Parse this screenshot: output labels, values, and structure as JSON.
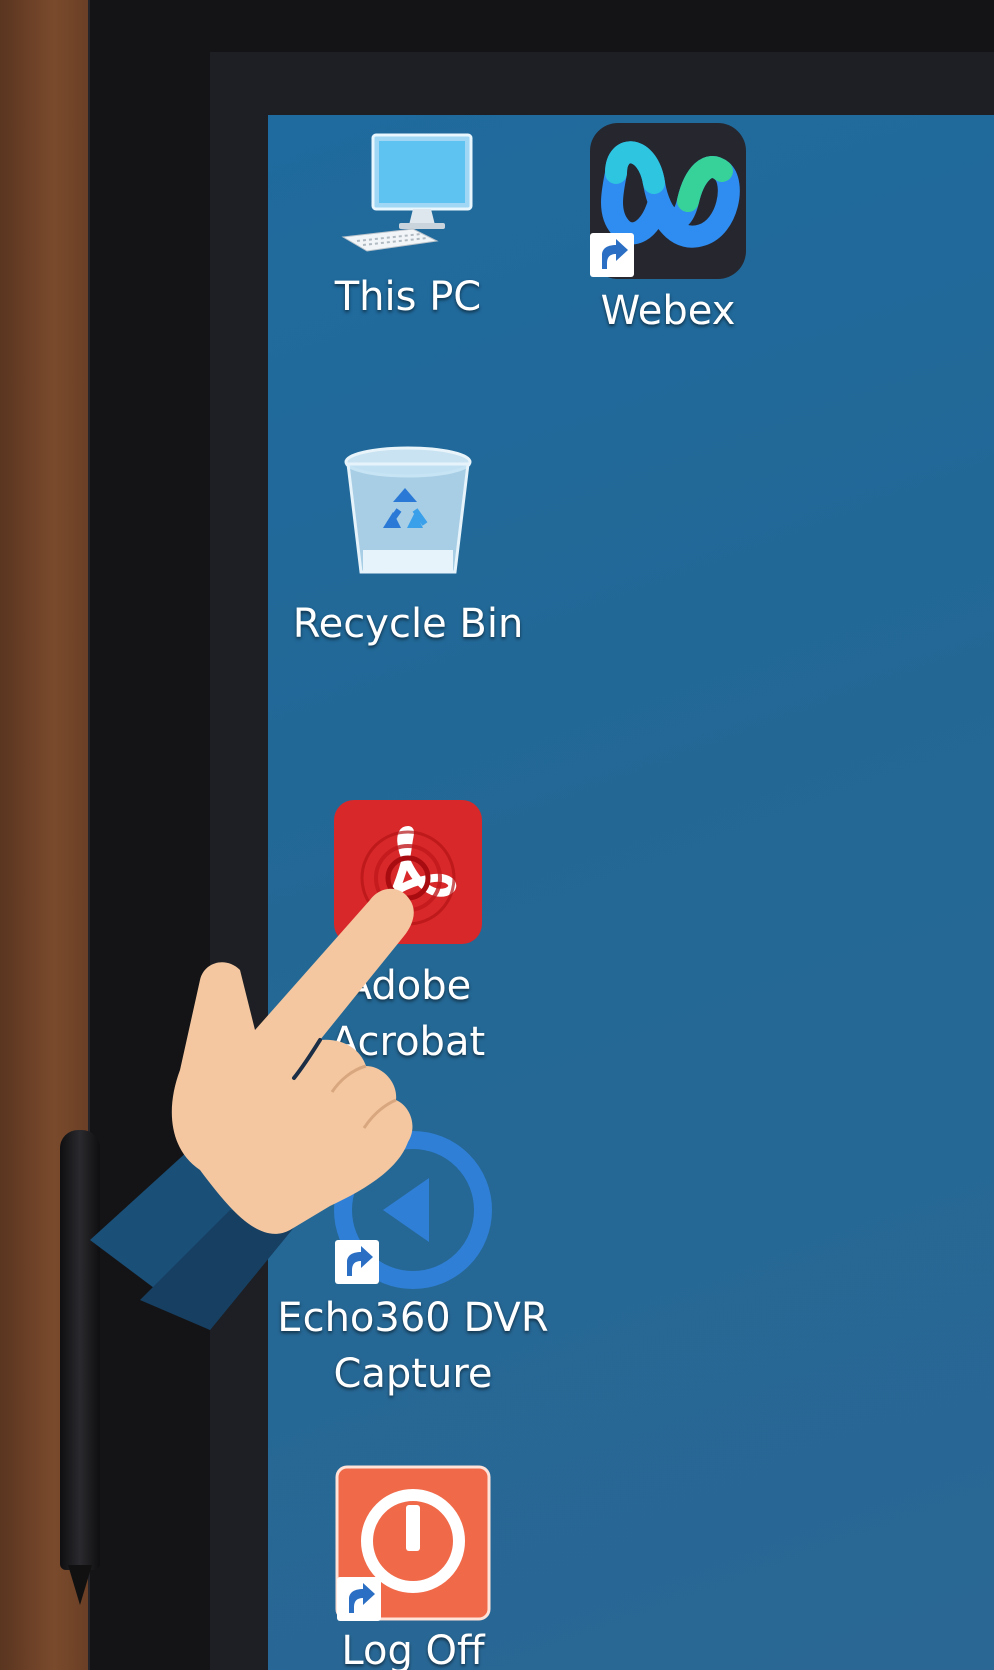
{
  "desktop": {
    "icons": [
      {
        "label": "This PC",
        "icon": "computer-icon",
        "shortcut": false
      },
      {
        "label": "Webex",
        "icon": "webex-icon",
        "shortcut": true
      },
      {
        "label": "Recycle Bin",
        "icon": "recycle-bin-icon",
        "shortcut": false
      },
      {
        "label_line1": "Adobe",
        "label_line2": "Acrobat",
        "icon": "adobe-acrobat-icon",
        "shortcut": true
      },
      {
        "label_line1": "Echo360 DVR",
        "label_line2": "Capture",
        "icon": "echo360-icon",
        "shortcut": true
      },
      {
        "label": "Log Off",
        "icon": "power-icon",
        "shortcut": true
      }
    ],
    "overlay": {
      "icon": "pointing-hand-icon",
      "target": "Adobe Acrobat"
    }
  },
  "colors": {
    "desktop_background": "#236895",
    "acrobat_red": "#d8282a",
    "logoff_orange": "#f06a4a",
    "echo_blue": "#2f7fd6"
  }
}
